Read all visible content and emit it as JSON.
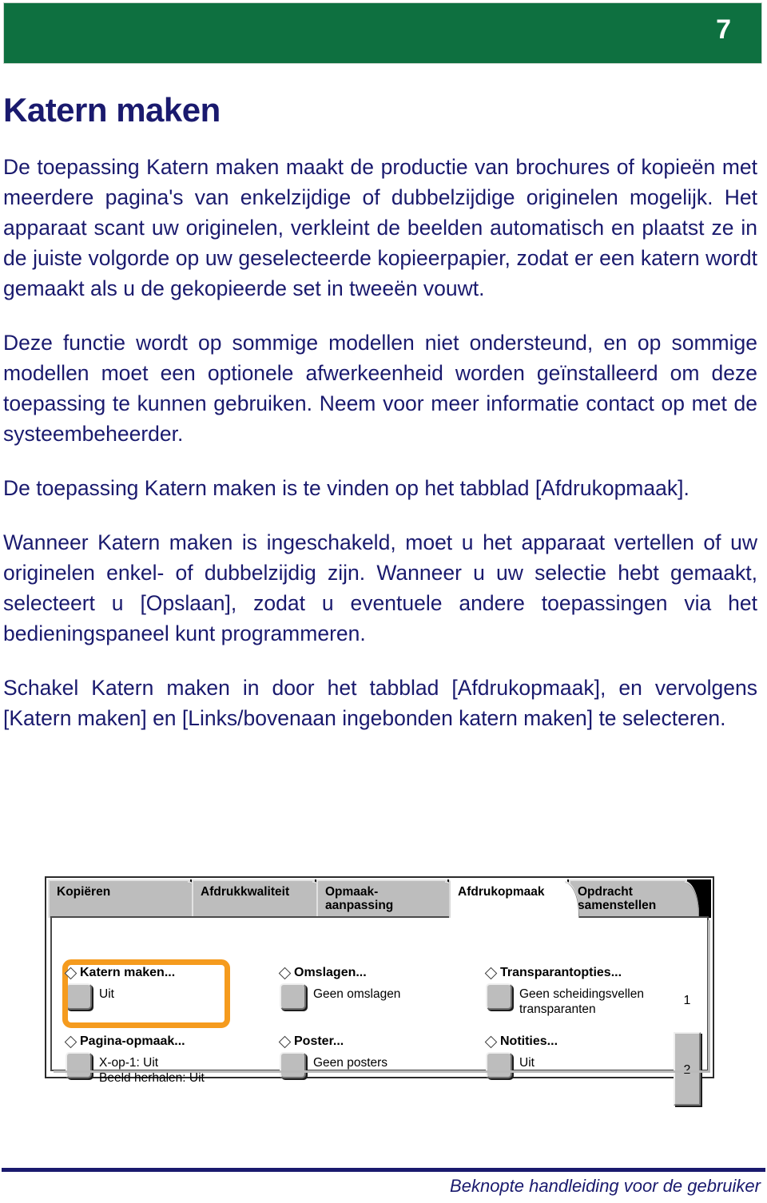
{
  "header": {
    "page_number": "7",
    "band_color": "#0E7040"
  },
  "title": "Katern maken",
  "title_color": "#1a1a6e",
  "paragraphs": [
    "De toepassing Katern maken maakt de productie van brochures of kopieën met meerdere pagina's van enkelzijdige of dubbelzijdige originelen mogelijk. Het apparaat scant uw originelen, verkleint de beelden automatisch en plaatst ze in de juiste volgorde op uw geselecteerde kopieerpapier, zodat er een katern wordt gemaakt als u de gekopieerde set in tweeën vouwt.",
    "Deze functie wordt op sommige modellen niet ondersteund, en op sommige modellen moet een optionele afwerkeenheid worden geïnstalleerd om deze toepassing te kunnen gebruiken. Neem voor meer informatie contact op met de systeembeheerder.",
    "De toepassing Katern maken is te vinden op het tabblad [Afdrukopmaak].",
    "Wanneer Katern maken is ingeschakeld, moet u het apparaat vertellen of uw originelen enkel- of dubbelzijdig zijn. Wanneer u uw selectie hebt gemaakt, selecteert u [Opslaan], zodat u eventuele andere toepassingen via het bedieningspaneel kunt programmeren.",
    "Schakel Katern maken in door het tabblad [Afdrukopmaak], en vervolgens [Katern maken] en [Links/bovenaan ingebonden katern maken] te selecteren."
  ],
  "ui_panel": {
    "highlight_color": "#F59B1E",
    "tabs": [
      {
        "label": "Kopiëren",
        "active": false
      },
      {
        "label": "Afdrukkwaliteit",
        "active": false
      },
      {
        "label": "Opmaak-\naanpassing",
        "active": false
      },
      {
        "label": "Afdrukopmaak",
        "active": true
      },
      {
        "label": "Opdracht\nsamenstellen",
        "active": false
      }
    ],
    "options": [
      {
        "title": "Katern maken...",
        "value": "Uit",
        "highlighted": true
      },
      {
        "title": "Omslagen...",
        "value": "Geen omslagen",
        "highlighted": false
      },
      {
        "title": "Transparantopties...",
        "value": "Geen scheidingsvellen\ntransparanten",
        "highlighted": false
      },
      {
        "title": "Pagina-opmaak...",
        "value": "X-op-1: Uit\nBeeld herhalen: Uit",
        "highlighted": false
      },
      {
        "title": "Poster...",
        "value": "Geen posters",
        "highlighted": false
      },
      {
        "title": "Notities...",
        "value": "Uit",
        "highlighted": false
      }
    ],
    "page_tabs": [
      {
        "label": "1",
        "selected": true
      },
      {
        "label": "2",
        "selected": false
      }
    ]
  },
  "footer": {
    "text": "Beknopte handleiding voor de gebruiker"
  }
}
